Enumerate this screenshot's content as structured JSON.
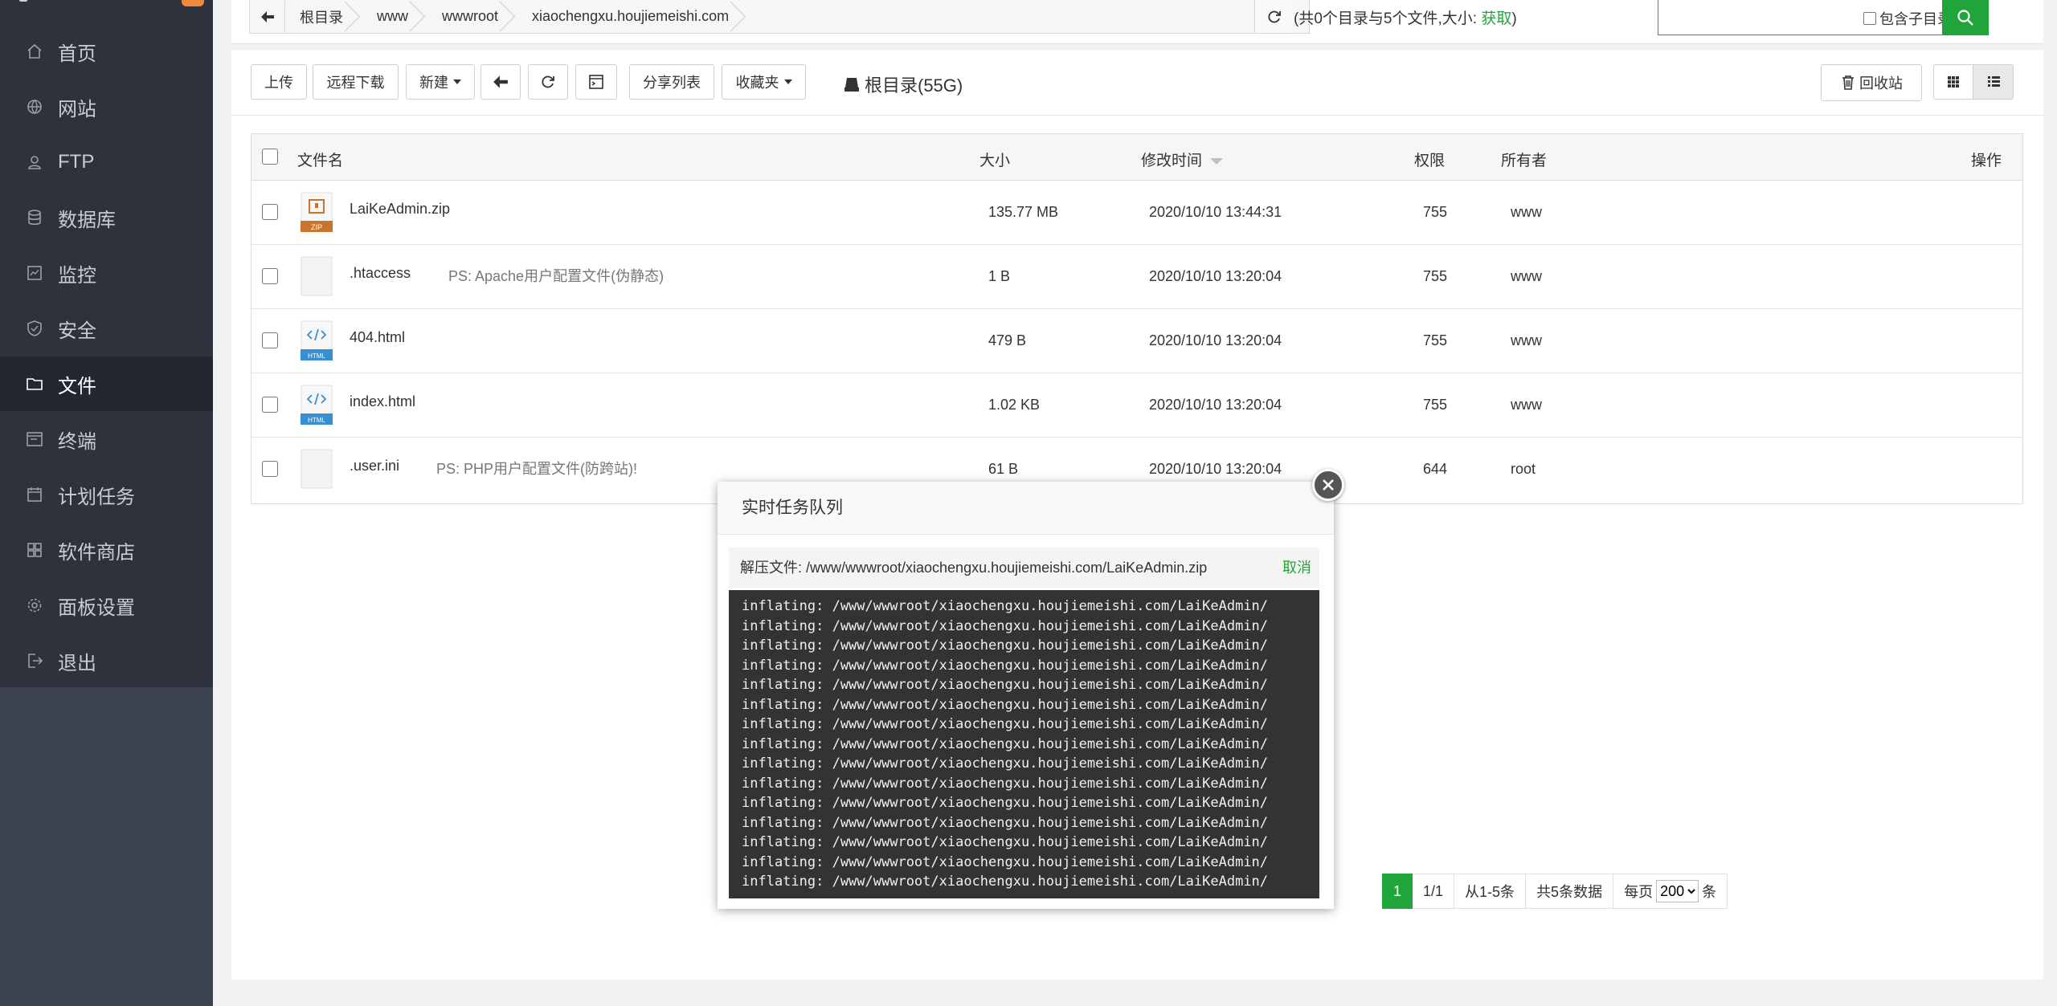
{
  "sidebar": {
    "items": [
      {
        "label": "首页",
        "icon": "home-icon",
        "active": false
      },
      {
        "label": "网站",
        "icon": "globe-icon",
        "active": false
      },
      {
        "label": "FTP",
        "icon": "ftp-icon",
        "active": false
      },
      {
        "label": "数据库",
        "icon": "database-icon",
        "active": false
      },
      {
        "label": "监控",
        "icon": "monitor-icon",
        "active": false
      },
      {
        "label": "安全",
        "icon": "shield-icon",
        "active": false
      },
      {
        "label": "文件",
        "icon": "folder-icon",
        "active": true
      },
      {
        "label": "终端",
        "icon": "terminal-icon",
        "active": false
      },
      {
        "label": "计划任务",
        "icon": "calendar-icon",
        "active": false
      },
      {
        "label": "软件商店",
        "icon": "apps-icon",
        "active": false
      },
      {
        "label": "面板设置",
        "icon": "gear-icon",
        "active": false
      },
      {
        "label": "退出",
        "icon": "logout-icon",
        "active": false
      }
    ]
  },
  "breadcrumb": {
    "items": [
      "根目录",
      "www",
      "wwwroot",
      "xiaochengxu.houjiemeishi.com"
    ]
  },
  "dir_info": {
    "prefix": "(共0个目录与5个文件,大小: ",
    "link": "获取",
    "suffix": ")"
  },
  "search": {
    "placeholder": "",
    "include_subdir_label": "包含子目录"
  },
  "toolbar": {
    "upload": "上传",
    "remote_download": "远程下载",
    "new": "新建",
    "share_list": "分享列表",
    "favorites": "收藏夹",
    "root_label": "根目录(55G)",
    "recycle": "回收站"
  },
  "table": {
    "headers": {
      "name": "文件名",
      "size": "大小",
      "mtime": "修改时间",
      "perm": "权限",
      "owner": "所有者",
      "ops": "操作"
    },
    "rows": [
      {
        "name": "LaiKeAdmin.zip",
        "note": "",
        "size": "135.77 MB",
        "mtime": "2020/10/10 13:44:31",
        "perm": "755",
        "owner": "www",
        "type": "zip"
      },
      {
        "name": ".htaccess",
        "note": "PS: Apache用户配置文件(伪静态)",
        "size": "1 B",
        "mtime": "2020/10/10 13:20:04",
        "perm": "755",
        "owner": "www",
        "type": "blank"
      },
      {
        "name": "404.html",
        "note": "",
        "size": "479 B",
        "mtime": "2020/10/10 13:20:04",
        "perm": "755",
        "owner": "www",
        "type": "html"
      },
      {
        "name": "index.html",
        "note": "",
        "size": "1.02 KB",
        "mtime": "2020/10/10 13:20:04",
        "perm": "755",
        "owner": "www",
        "type": "html"
      },
      {
        "name": ".user.ini",
        "note": "PS: PHP用户配置文件(防跨站)!",
        "size": "61 B",
        "mtime": "2020/10/10 13:20:04",
        "perm": "644",
        "owner": "root",
        "type": "blank"
      }
    ]
  },
  "pagination": {
    "current": "1",
    "pages": "1/1",
    "range": "从1-5条",
    "total": "共5条数据",
    "per_page_label": "每页",
    "per_page_value": "200",
    "unit": "条"
  },
  "modal": {
    "title": "实时任务队列",
    "task_text": "解压文件: /www/wwwroot/xiaochengxu.houjiemeishi.com/LaiKeAdmin.zip",
    "cancel": "取消",
    "console_lines": [
      "inflating: /www/wwwroot/xiaochengxu.houjiemeishi.com/LaiKeAdmin/",
      "inflating: /www/wwwroot/xiaochengxu.houjiemeishi.com/LaiKeAdmin/",
      "inflating: /www/wwwroot/xiaochengxu.houjiemeishi.com/LaiKeAdmin/",
      "inflating: /www/wwwroot/xiaochengxu.houjiemeishi.com/LaiKeAdmin/",
      "inflating: /www/wwwroot/xiaochengxu.houjiemeishi.com/LaiKeAdmin/",
      "inflating: /www/wwwroot/xiaochengxu.houjiemeishi.com/LaiKeAdmin/",
      "inflating: /www/wwwroot/xiaochengxu.houjiemeishi.com/LaiKeAdmin/",
      "inflating: /www/wwwroot/xiaochengxu.houjiemeishi.com/LaiKeAdmin/",
      "inflating: /www/wwwroot/xiaochengxu.houjiemeishi.com/LaiKeAdmin/",
      "inflating: /www/wwwroot/xiaochengxu.houjiemeishi.com/LaiKeAdmin/",
      "inflating: /www/wwwroot/xiaochengxu.houjiemeishi.com/LaiKeAdmin/",
      "inflating: /www/wwwroot/xiaochengxu.houjiemeishi.com/LaiKeAdmin/",
      "inflating: /www/wwwroot/xiaochengxu.houjiemeishi.com/LaiKeAdmin/",
      "inflating: /www/wwwroot/xiaochengxu.houjiemeishi.com/LaiKeAdmin/",
      "inflating: /www/wwwroot/xiaochengxu.houjiemeishi.com/LaiKeAdmin/"
    ]
  },
  "colors": {
    "accent": "#20a53a",
    "sidebar_bg": "#2d323c",
    "sidebar_active": "#232830",
    "console_bg": "#333333"
  }
}
